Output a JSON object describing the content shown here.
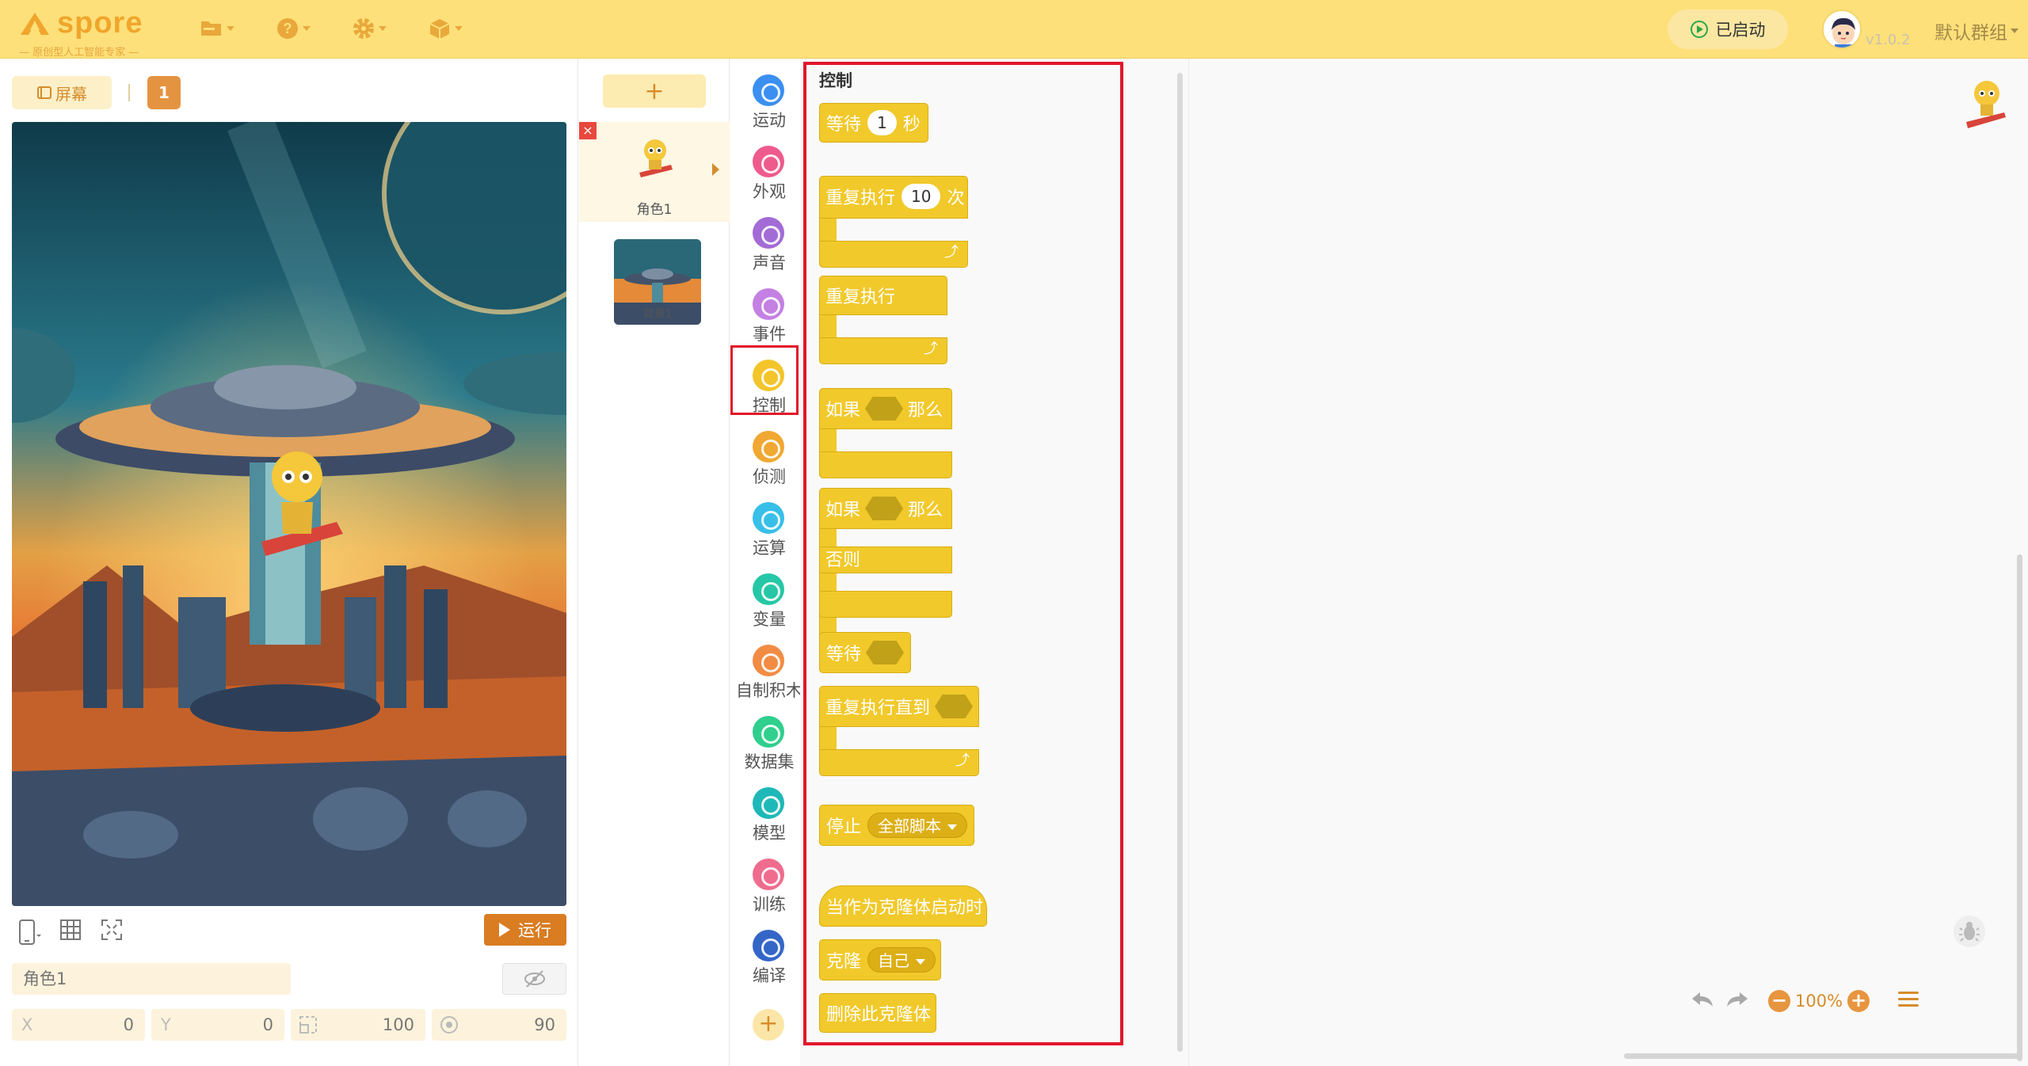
{
  "topbar": {
    "logo_text": "spore",
    "logo_sub": "— 原创型人工智能专家 —",
    "menu_icons": [
      "folder-icon",
      "help-icon",
      "gear-icon",
      "cube-icon"
    ],
    "status_label": "已启动",
    "version": "v1.0.2",
    "group_label": "默认群组"
  },
  "stage": {
    "screen_label": "屏幕",
    "screen_number": "1",
    "run_label": "运行",
    "sprite_name_placeholder": "角色1",
    "props": {
      "x_label": "X",
      "x_value": "0",
      "y_label": "Y",
      "y_value": "0",
      "size_value": "100",
      "direction_value": "90"
    }
  },
  "sprites": {
    "add_label": "+",
    "items": [
      {
        "name": "角色1"
      }
    ],
    "backdrop_label": "背景1"
  },
  "categories": [
    {
      "label": "运动",
      "color": "#3b8ff0"
    },
    {
      "label": "外观",
      "color": "#ee5a8c"
    },
    {
      "label": "声音",
      "color": "#a36bd6"
    },
    {
      "label": "事件",
      "color": "#c480e3"
    },
    {
      "label": "控制",
      "color": "#f3c52b"
    },
    {
      "label": "侦测",
      "color": "#f0a832"
    },
    {
      "label": "运算",
      "color": "#38bfe8"
    },
    {
      "label": "变量",
      "color": "#26c7a6"
    },
    {
      "label": "自制积木",
      "color": "#f28c44"
    },
    {
      "label": "数据集",
      "color": "#2fcf8d"
    },
    {
      "label": "模型",
      "color": "#1fb8b8"
    },
    {
      "label": "训练",
      "color": "#ef6c8e"
    },
    {
      "label": "编译",
      "color": "#3466c8"
    }
  ],
  "palette": {
    "title": "控制",
    "blocks": {
      "wait": {
        "label": "等待",
        "value": "1",
        "unit": "秒"
      },
      "repeat": {
        "label": "重复执行",
        "value": "10",
        "unit": "次"
      },
      "forever": {
        "label": "重复执行"
      },
      "if_then": {
        "label": "如果",
        "then": "那么"
      },
      "if_else": {
        "label": "如果",
        "then": "那么",
        "else": "否则"
      },
      "wait_until": {
        "label": "等待"
      },
      "repeat_until": {
        "label": "重复执行直到"
      },
      "stop": {
        "label": "停止",
        "option": "全部脚本"
      },
      "clone_start": {
        "label": "当作为克隆体启动时"
      },
      "clone": {
        "label": "克隆",
        "option": "自己"
      },
      "delete_clone": {
        "label": "删除此克隆体"
      }
    }
  },
  "code_area": {
    "zoom": "100%"
  }
}
